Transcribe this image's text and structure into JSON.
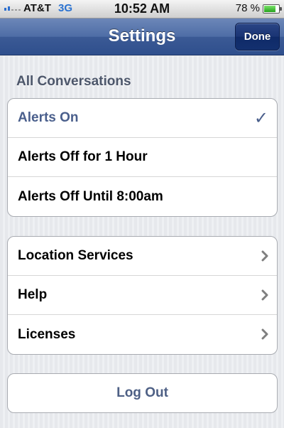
{
  "status_bar": {
    "carrier": "AT&T",
    "network": "3G",
    "time": "10:52 AM",
    "battery_percent": "78 %",
    "battery_level": 0.78
  },
  "nav": {
    "title": "Settings",
    "done_label": "Done"
  },
  "conversations": {
    "header": "All Conversations",
    "options": [
      {
        "label": "Alerts On",
        "selected": true
      },
      {
        "label": "Alerts Off for 1 Hour",
        "selected": false
      },
      {
        "label": "Alerts Off Until 8:00am",
        "selected": false
      }
    ],
    "check_glyph": "✓"
  },
  "links": [
    {
      "label": "Location Services",
      "icon": "chevron-right-icon"
    },
    {
      "label": "Help",
      "icon": "chevron-right-icon"
    },
    {
      "label": "Licenses",
      "icon": "chevron-right-icon"
    }
  ],
  "logout_label": "Log Out",
  "colors": {
    "nav_bar": "#3b5a95",
    "selected_text": "#4a5f8c",
    "network_text": "#2a72d1",
    "battery": "#25a11d"
  }
}
